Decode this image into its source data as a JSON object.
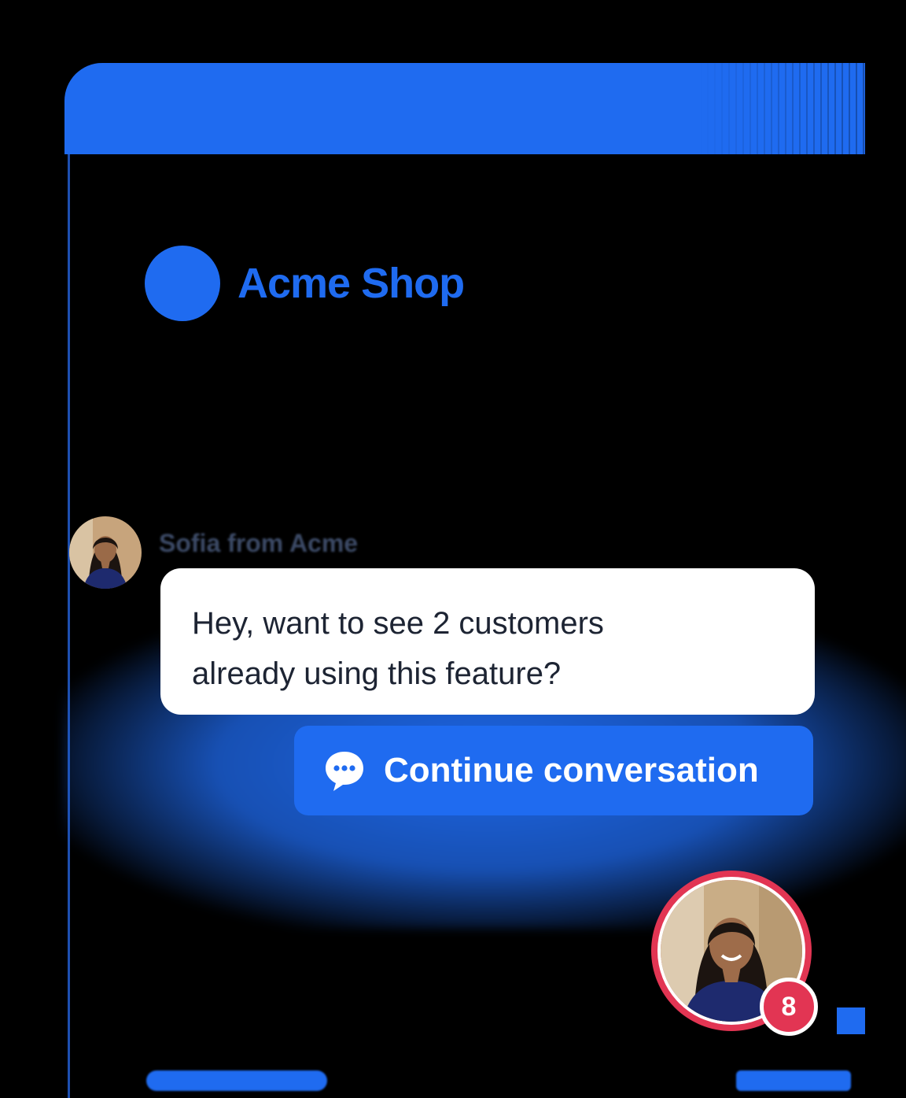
{
  "brand": {
    "name": "Acme Shop"
  },
  "message": {
    "sender": "Sofia from Acme",
    "lines": [
      "Hey, want to see 2 customers",
      "already using this feature?"
    ]
  },
  "cta": {
    "label": "Continue conversation",
    "icon": "chat-bubble-icon"
  },
  "launcher": {
    "badge_count": "8"
  },
  "colors": {
    "primary": "#1f6bf0",
    "badge": "#e23553",
    "text": "#1d2433"
  }
}
